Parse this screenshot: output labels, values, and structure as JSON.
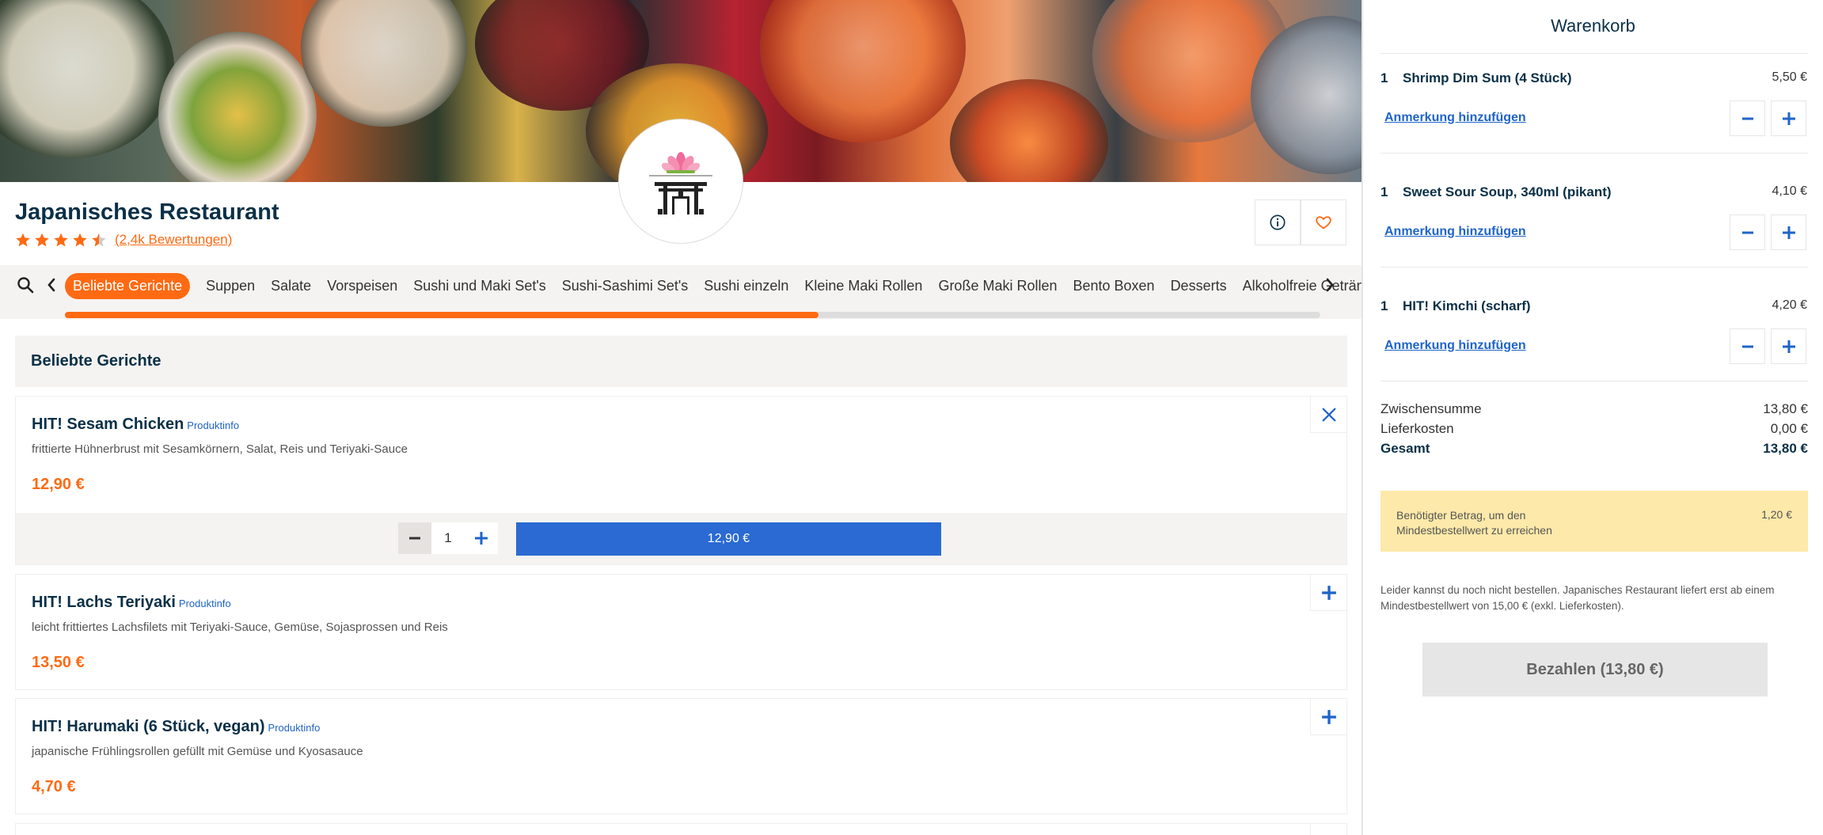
{
  "restaurant": {
    "name": "Japanisches Restaurant",
    "rating": 4.5,
    "reviews_label": "(2,4k Bewertungen)"
  },
  "colors": {
    "accent": "#ff6a13",
    "primary_blue": "#2a6ad2",
    "navy": "#0a3047",
    "section_bg": "#f5f3f1",
    "warning_bg": "#fde9a9"
  },
  "header_buttons": {
    "info_icon": "info-icon",
    "favorite_icon": "heart-icon"
  },
  "categories": {
    "items": [
      "Beliebte Gerichte",
      "Suppen",
      "Salate",
      "Vorspeisen",
      "Sushi und Maki Set's",
      "Sushi-Sashimi Set's",
      "Sushi einzeln",
      "Kleine Maki Rollen",
      "Große Maki Rollen",
      "Bento Boxen",
      "Desserts",
      "Alkoholfreie Getränke"
    ],
    "active_index": 0,
    "scroll_progress": 0.6
  },
  "section": {
    "title": "Beliebte Gerichte"
  },
  "products": [
    {
      "name": "HIT! Sesam Chicken",
      "info_label": "Produktinfo",
      "description": "frittierte Hühnerbrust mit Sesamkörnern, Salat, Reis und Teriyaki-Sauce",
      "price": "12,90 €",
      "expanded": true,
      "quantity": "1",
      "add_button_label": "12,90 €"
    },
    {
      "name": "HIT! Lachs Teriyaki",
      "info_label": "Produktinfo",
      "description": "leicht frittiertes Lachsfilets mit Teriyaki-Sauce, Gemüse, Sojasprossen und Reis",
      "price": "13,50 €",
      "expanded": false
    },
    {
      "name": "HIT! Harumaki (6 Stück, vegan)",
      "info_label": "Produktinfo",
      "description": "japanische Frühlingsrollen gefüllt mit Gemüse und Kyosasauce",
      "price": "4,70 €",
      "expanded": false
    }
  ],
  "cart": {
    "title": "Warenkorb",
    "note_label": "Anmerkung hinzufügen",
    "items": [
      {
        "qty": "1",
        "name": "Shrimp Dim Sum (4 Stück)",
        "price": "5,50 €"
      },
      {
        "qty": "1",
        "name": "Sweet Sour Soup, 340ml (pikant)",
        "price": "4,10 €"
      },
      {
        "qty": "1",
        "name": "HIT! Kimchi (scharf)",
        "price": "4,20 €"
      }
    ],
    "subtotal_label": "Zwischensumme",
    "subtotal": "13,80 €",
    "delivery_label": "Lieferkosten",
    "delivery": "0,00 €",
    "total_label": "Gesamt",
    "total": "13,80 €",
    "min_order_text": "Benötigter Betrag, um den Mindestbestellwert zu erreichen",
    "min_order_value": "1,20 €",
    "info_text": "Leider kannst du noch nicht bestellen. Japanisches Restaurant liefert erst ab einem Mindestbestellwert von 15,00 € (exkl. Lieferkosten).",
    "pay_label": "Bezahlen (13,80 €)"
  }
}
